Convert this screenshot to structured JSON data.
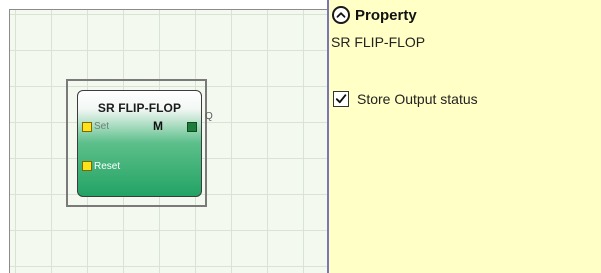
{
  "canvas": {
    "block": {
      "title": "SR FLIP-FLOP",
      "mode": "M",
      "inputs": [
        {
          "label": "Set"
        },
        {
          "label": "Reset"
        }
      ],
      "output": {
        "label": "Q"
      },
      "colors": {
        "body_top": "#ffffff",
        "body_bottom": "#23a365",
        "input_pin": "#ffe21a",
        "output_pin": "#1f7d3c"
      }
    }
  },
  "panel": {
    "title": "Property",
    "subtitle": "SR FLIP-FLOP",
    "checkbox": {
      "label": "Store Output status",
      "checked": true
    },
    "colors": {
      "background": "#ffffc6",
      "divider": "#7a76b6"
    }
  }
}
